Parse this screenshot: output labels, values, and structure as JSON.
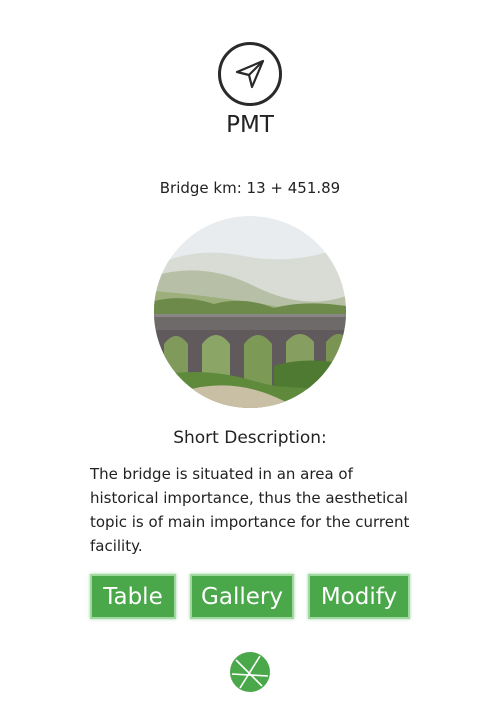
{
  "header": {
    "icon": "navigation-arrow-icon",
    "title": "PMT"
  },
  "bridge": {
    "km_label": "Bridge km: 13 + 451.89",
    "photo": "arched-viaduct-photo"
  },
  "description": {
    "heading": "Short Description:",
    "text": "The bridge is situated in an area of historical importance, thus the aesthetical topic is of main importance for the current facility."
  },
  "actions": {
    "table_label": "Table",
    "gallery_label": "Gallery",
    "modify_label": "Modify"
  },
  "footer": {
    "icon": "circle-segments-icon"
  },
  "colors": {
    "accent": "#4aa84a",
    "text": "#222222",
    "background": "#ffffff"
  }
}
